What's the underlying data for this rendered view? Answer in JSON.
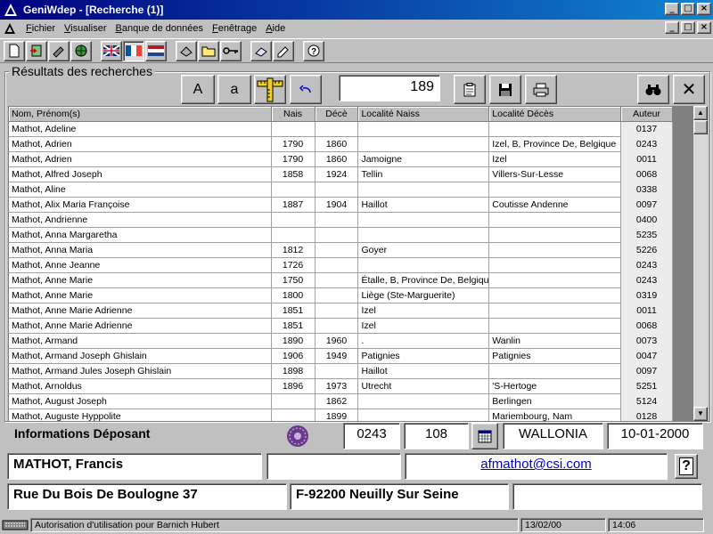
{
  "window": {
    "title": "GeniWdep - [Recherche (1)]",
    "minimize": "_",
    "maximize": "□",
    "close": "×"
  },
  "menubar": {
    "items": [
      "Fichier",
      "Visualiser",
      "Banque de données",
      "Fenêtrage",
      "Aide"
    ]
  },
  "toolbar": {
    "icons": [
      "new-file-icon",
      "open-icon",
      "tools-icon",
      "globe-icon",
      "flag-uk-icon",
      "flag-fr-icon",
      "flag-nl-icon",
      "scan-icon",
      "folder-icon",
      "key-icon",
      "eraser-icon",
      "edit-icon",
      "help-icon"
    ]
  },
  "results": {
    "title": "Résultats des recherches",
    "btn_upper": "A",
    "btn_lower": "a",
    "count": "189",
    "close_label": "✕",
    "columns": [
      "Nom, Prénom(s)",
      "Nais",
      "Décè",
      "Localité Naiss",
      "Localité Décès",
      "Auteur"
    ],
    "rows": [
      [
        "Mathot, Adeline",
        "",
        "",
        "",
        "",
        "0137"
      ],
      [
        "Mathot, Adrien",
        "1790",
        "1860",
        "",
        "Izel, B, Province De, Belgique",
        "0243"
      ],
      [
        "Mathot, Adrien",
        "1790",
        "1860",
        "Jamoigne",
        "Izel",
        "0011"
      ],
      [
        "Mathot, Alfred Joseph",
        "1858",
        "1924",
        "Tellin",
        "Villers-Sur-Lesse",
        "0068"
      ],
      [
        "Mathot, Aline",
        "",
        "",
        "",
        "",
        "0338"
      ],
      [
        "Mathot, Alix Maria Françoise",
        "1887",
        "1904",
        "Haillot",
        "Coutisse Andenne",
        "0097"
      ],
      [
        "Mathot, Andrienne",
        "",
        "",
        "",
        "",
        "0400"
      ],
      [
        "Mathot, Anna Margaretha",
        "",
        "",
        "",
        "",
        "5235"
      ],
      [
        "Mathot, Anna Maria",
        "1812",
        "",
        "Goyer",
        "",
        "5226"
      ],
      [
        "Mathot, Anne Jeanne",
        "1726",
        "",
        "",
        "",
        "0243"
      ],
      [
        "Mathot, Anne Marie",
        "1750",
        "",
        "Étalle, B, Province De, Belgique",
        "",
        "0243"
      ],
      [
        "Mathot, Anne Marie",
        "1800",
        "",
        "Liège (Ste-Marguerite)",
        "",
        "0319"
      ],
      [
        "Mathot, Anne Marie Adrienne",
        "1851",
        "",
        "Izel",
        "",
        "0011"
      ],
      [
        "Mathot, Anne Marie Adrienne",
        "1851",
        "",
        "Izel",
        "",
        "0068"
      ],
      [
        "Mathot, Armand",
        "1890",
        "1960",
        ".",
        "Wanlin",
        "0073"
      ],
      [
        "Mathot, Armand Joseph Ghislain",
        "1906",
        "1949",
        "Patignies",
        "Patignies",
        "0047"
      ],
      [
        "Mathot, Armand Jules Joseph Ghislain",
        "1898",
        "",
        "Haillot",
        "",
        "0097"
      ],
      [
        "Mathot, Arnoldus",
        "1896",
        "1973",
        "Utrecht",
        "'S-Hertoge",
        "5251"
      ],
      [
        "Mathot, August Joseph",
        "",
        "1862",
        "",
        "Berlingen",
        "5124"
      ],
      [
        "Mathot, Auguste Hyppolite",
        "",
        "1899",
        "",
        "Mariembourg, Nam",
        "0128"
      ]
    ]
  },
  "info": {
    "label": "Informations Déposant",
    "code": "0243",
    "num": "108",
    "region": "WALLONIA",
    "date": "10-01-2000",
    "name": "MATHOT, Francis",
    "email": "afmathot@csi.com",
    "help": "?",
    "street": "Rue Du Bois De Boulogne 37",
    "city": "F-92200  Neuilly Sur Seine"
  },
  "status": {
    "message": "Autorisation d'utilisation pour Barnich Hubert",
    "date": "13/02/00",
    "time": "14:06"
  },
  "colors": {
    "titlebar_start": "#000080",
    "titlebar_end": "#1084d0",
    "face": "#c0c0c0",
    "link": "#0000cc"
  }
}
